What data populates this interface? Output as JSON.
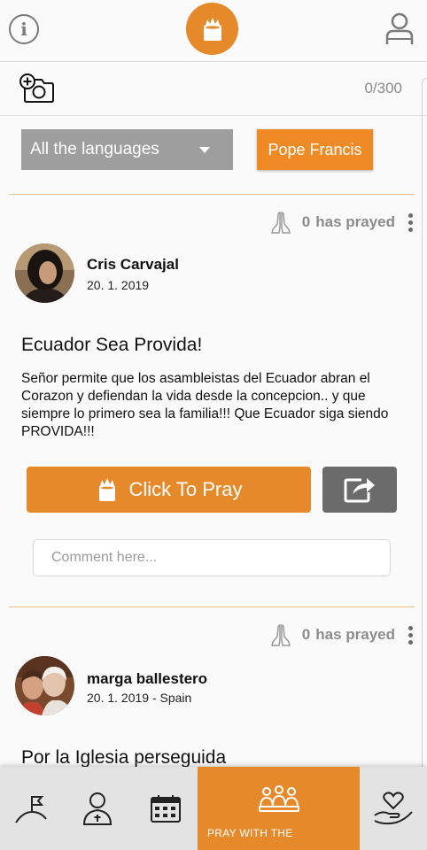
{
  "upload": {
    "counter": "0/300"
  },
  "filters": {
    "language": "All the languages",
    "pope_button": "Pope Francis"
  },
  "posts": [
    {
      "prayed_count": "0",
      "prayed_label": "has prayed",
      "author": "Cris Carvajal",
      "date": "20. 1. 2019",
      "title": "Ecuador Sea Provida!",
      "body": "Señor permite que los asambleistas del Ecuador abran el Corazon y defiendan la vida desde la concepcion.. y que siempre lo primero sea la familia!!! Que Ecuador siga siendo PROVIDA!!!",
      "pray_button": "Click To Pray",
      "comment_placeholder": "Comment here..."
    },
    {
      "prayed_count": "0",
      "prayed_label": "has prayed",
      "author": "marga ballestero",
      "date": "20. 1. 2019 - Spain",
      "title": "Por la Iglesia perseguida"
    }
  ],
  "nav": {
    "active_label": "PRAY WITH THE"
  },
  "icons": {
    "info": "info-icon",
    "logo": "candle-logo-icon",
    "profile": "user-icon",
    "camera": "add-photo-icon",
    "hands": "praying-hands-icon",
    "menu": "kebab-menu-icon",
    "share": "share-icon",
    "flag": "flag-icon",
    "priest": "priest-icon",
    "calendar": "calendar-icon",
    "group": "group-icon",
    "heart": "heart-hand-icon"
  },
  "colors": {
    "accent": "#e5892a",
    "pope_button": "#f08a24",
    "select": "#9e9e9e",
    "share": "#6b6b6b",
    "nav_bg": "#e3e3e3"
  }
}
